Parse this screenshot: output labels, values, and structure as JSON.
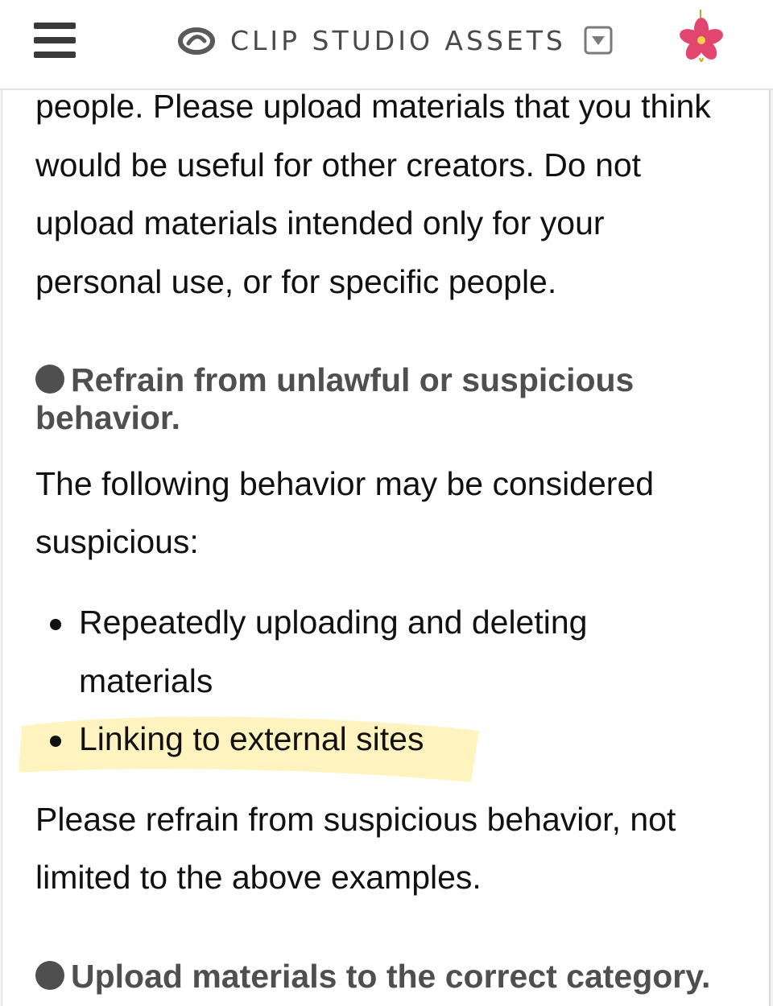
{
  "header": {
    "menu_icon": "hamburger-menu-icon",
    "logo_icon": "clip-studio-logo-icon",
    "title": "CLIP STUDIO ASSETS",
    "dropdown_icon": "dropdown-arrow-icon",
    "corner_icon": "pink-flower-icon"
  },
  "colors": {
    "header_background": "#ffffff",
    "text": "#111111",
    "heading": "#4f4f4f",
    "highlight": "#fff3b8",
    "flower": "#e2456e"
  },
  "content": {
    "intro_lines": [
      "people. Please upload materials that you think",
      "would be useful for other creators. Do not",
      "upload materials intended only for your",
      "personal use, or for specific people."
    ],
    "section1_heading_lines": [
      "Refrain from unlawful or suspicious",
      "behavior."
    ],
    "section1_intro_lines": [
      "The following behavior may be considered",
      "suspicious:"
    ],
    "bullets": [
      {
        "lines": [
          "Repeatedly uploading and deleting",
          "materials"
        ]
      },
      {
        "lines": [
          "Linking to external sites"
        ],
        "highlighted": true
      }
    ],
    "closing_lines": [
      "Please refrain from suspicious behavior, not",
      "limited to the above examples."
    ],
    "section2_heading": "Upload materials to the correct category."
  }
}
